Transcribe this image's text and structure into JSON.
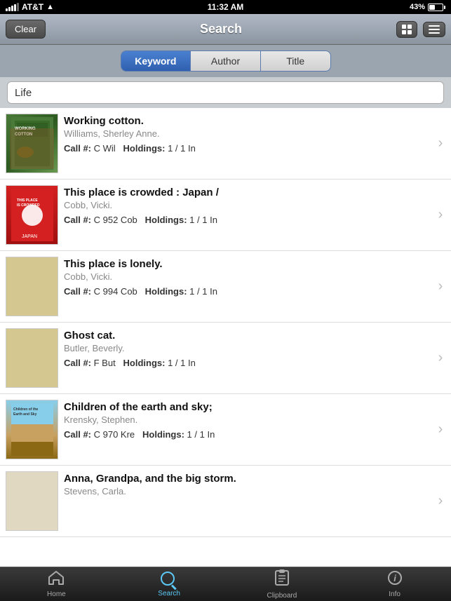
{
  "statusBar": {
    "carrier": "AT&T",
    "time": "11:32 AM",
    "battery": "43%"
  },
  "navBar": {
    "clearLabel": "Clear",
    "title": "Search"
  },
  "segmentControl": {
    "options": [
      "Keyword",
      "Author",
      "Title"
    ],
    "activeIndex": 0
  },
  "searchInput": {
    "value": "Life",
    "placeholder": "Search"
  },
  "books": [
    {
      "title": "Working cotton.",
      "author": "Williams, Sherley Anne.",
      "callNumber": "C Wil",
      "holdings": "1 / 1 In",
      "hasCover": true,
      "coverStyle": "cover-1"
    },
    {
      "title": "This place is crowded : Japan /",
      "author": "Cobb, Vicki.",
      "callNumber": "C 952 Cob",
      "holdings": "1 / 1 In",
      "hasCover": true,
      "coverStyle": "cover-2"
    },
    {
      "title": "This place is lonely.",
      "author": "Cobb, Vicki.",
      "callNumber": "C 994 Cob",
      "holdings": "1 / 1 In",
      "hasCover": false,
      "coverStyle": "cover-plain"
    },
    {
      "title": "Ghost cat.",
      "author": "Butler, Beverly.",
      "callNumber": "F But",
      "holdings": "1 / 1 In",
      "hasCover": false,
      "coverStyle": "cover-plain"
    },
    {
      "title": "Children of the earth and sky;",
      "author": "Krensky, Stephen.",
      "callNumber": "C 970 Kre",
      "holdings": "1 / 1 In",
      "hasCover": true,
      "coverStyle": "cover-5"
    },
    {
      "title": "Anna, Grandpa, and the big storm.",
      "author": "Stevens, Carla.",
      "callNumber": "",
      "holdings": "",
      "hasCover": false,
      "coverStyle": "cover-plain"
    }
  ],
  "tabs": [
    {
      "label": "Home",
      "icon": "home-icon",
      "active": false
    },
    {
      "label": "Search",
      "icon": "search-icon",
      "active": true
    },
    {
      "label": "Clipboard",
      "icon": "clipboard-icon",
      "active": false
    },
    {
      "label": "Info",
      "icon": "info-icon",
      "active": false
    }
  ],
  "labels": {
    "callNumber": "Call #:",
    "holdings": "Holdings:",
    "chevron": "›"
  }
}
